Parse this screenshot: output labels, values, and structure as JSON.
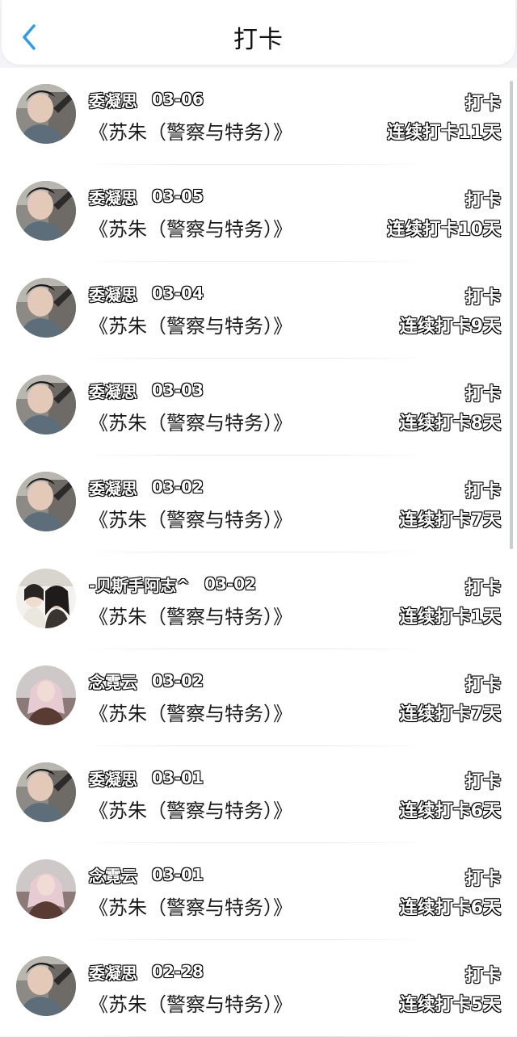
{
  "header": {
    "title": "打卡",
    "back_icon": "chevron-left-icon",
    "accent": "#2f9bf0"
  },
  "records": [
    {
      "user": "委凝思",
      "date": "03-06",
      "book": "《苏朱（警察与特务）》",
      "action": "打卡",
      "streak": "连续打卡11天",
      "avatar": "male"
    },
    {
      "user": "委凝思",
      "date": "03-05",
      "book": "《苏朱（警察与特务）》",
      "action": "打卡",
      "streak": "连续打卡10天",
      "avatar": "male"
    },
    {
      "user": "委凝思",
      "date": "03-04",
      "book": "《苏朱（警察与特务）》",
      "action": "打卡",
      "streak": "连续打卡9天",
      "avatar": "male"
    },
    {
      "user": "委凝思",
      "date": "03-03",
      "book": "《苏朱（警察与特务）》",
      "action": "打卡",
      "streak": "连续打卡8天",
      "avatar": "male"
    },
    {
      "user": "委凝思",
      "date": "03-02",
      "book": "《苏朱（警察与特务）》",
      "action": "打卡",
      "streak": "连续打卡7天",
      "avatar": "male"
    },
    {
      "user": "-贝斯手阿志^",
      "date": "03-02",
      "book": "《苏朱（警察与特务）》",
      "action": "打卡",
      "streak": "连续打卡1天",
      "avatar": "couple"
    },
    {
      "user": "念霓云",
      "date": "03-02",
      "book": "《苏朱（警察与特务）》",
      "action": "打卡",
      "streak": "连续打卡7天",
      "avatar": "female"
    },
    {
      "user": "委凝思",
      "date": "03-01",
      "book": "《苏朱（警察与特务）》",
      "action": "打卡",
      "streak": "连续打卡6天",
      "avatar": "male"
    },
    {
      "user": "念霓云",
      "date": "03-01",
      "book": "《苏朱（警察与特务）》",
      "action": "打卡",
      "streak": "连续打卡6天",
      "avatar": "female"
    },
    {
      "user": "委凝思",
      "date": "02-28",
      "book": "《苏朱（警察与特务）》",
      "action": "打卡",
      "streak": "连续打卡5天",
      "avatar": "male"
    }
  ]
}
